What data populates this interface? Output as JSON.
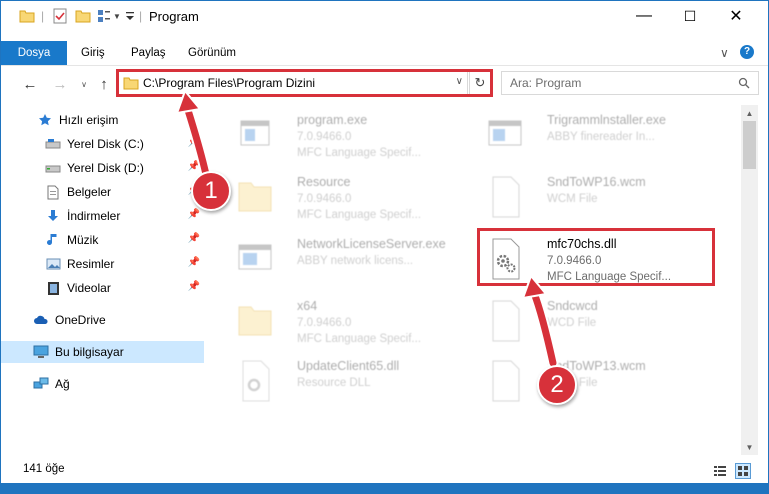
{
  "window": {
    "title": "Program",
    "controls": {
      "minimize": "—",
      "maximize": "☐",
      "close": "✕"
    }
  },
  "ribbon": {
    "tabs": [
      "Dosya",
      "Giriş",
      "Paylaş",
      "Görünüm"
    ],
    "collapse_glyph": "∨",
    "help_glyph": "?"
  },
  "address": {
    "path": "C:\\Program Files\\Program Dizini"
  },
  "search": {
    "placeholder": "Ara: Program"
  },
  "nav": {
    "items": [
      {
        "label": "Hızlı erişim",
        "icon": "star-icon"
      },
      {
        "label": "Yerel Disk (C:)",
        "icon": "drive-icon"
      },
      {
        "label": "Yerel Disk (D:)",
        "icon": "drive-icon"
      },
      {
        "label": "Belgeler",
        "icon": "document-icon"
      },
      {
        "label": "İndirmeler",
        "icon": "download-icon"
      },
      {
        "label": "Müzik",
        "icon": "music-icon"
      },
      {
        "label": "Resimler",
        "icon": "pictures-icon"
      },
      {
        "label": "Videolar",
        "icon": "video-icon"
      },
      {
        "label": "OneDrive",
        "icon": "cloud-icon"
      },
      {
        "label": "Bu bilgisayar",
        "icon": "computer-icon"
      },
      {
        "label": "Ağ",
        "icon": "network-icon"
      }
    ]
  },
  "files": [
    {
      "name": "program.exe",
      "line2": "7.0.9466.0",
      "line3": "MFC Language Specif..."
    },
    {
      "name": "Trigrammlnstaller.exe",
      "line2": "ABBY finereader In...",
      "line3": ""
    },
    {
      "name": "Resource",
      "line2": "7.0.9466.0",
      "line3": "MFC Language Specif..."
    },
    {
      "name": "SndToWP16.wcm",
      "line2": "WCM File",
      "line3": ""
    },
    {
      "name": "NetworkLicenseServer.exe",
      "line2": "ABBY network licens...",
      "line3": ""
    },
    {
      "name": "mfc70chs.dll",
      "line2": "7.0.9466.0",
      "line3": "MFC Language Specif..."
    },
    {
      "name": "x64",
      "line2": "7.0.9466.0",
      "line3": "MFC Language Specif..."
    },
    {
      "name": "Sndcwcd",
      "line2": "WCD File",
      "line3": ""
    },
    {
      "name": "UpdateClient65.dll",
      "line2": "Resource DLL",
      "line3": ""
    },
    {
      "name": "SndToWP13.wcm",
      "line2": "WCM File",
      "line3": ""
    }
  ],
  "status": {
    "count": "141 öğe"
  },
  "annotations": {
    "step1": "1",
    "step2": "2",
    "color": "#d7313a"
  }
}
